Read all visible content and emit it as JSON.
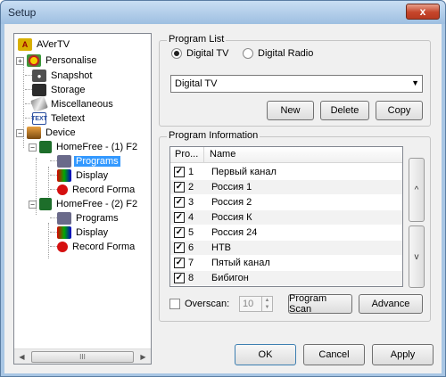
{
  "window": {
    "title": "Setup",
    "close_glyph": "x"
  },
  "tree": {
    "root": "AVerTV",
    "items": [
      {
        "label": "Personalise",
        "icon": "personalise-icon"
      },
      {
        "label": "Snapshot",
        "icon": "camera-icon"
      },
      {
        "label": "Storage",
        "icon": "storage-icon"
      },
      {
        "label": "Miscellaneous",
        "icon": "misc-icon"
      },
      {
        "label": "Teletext",
        "icon": "teletext-icon",
        "icon_text": "TEXT"
      },
      {
        "label": "Device",
        "icon": "device-icon"
      }
    ],
    "devices": [
      {
        "label": "HomeFree - (1) F2",
        "children": [
          "Programs",
          "Display",
          "Record Forma"
        ]
      },
      {
        "label": "HomeFree - (2) F2",
        "children": [
          "Programs",
          "Display",
          "Record Forma"
        ]
      }
    ],
    "expander_plus": "+",
    "expander_minus": "−",
    "scroll_thumb_grip": "III"
  },
  "program_list": {
    "title": "Program List",
    "radio_tv": "Digital TV",
    "radio_radio": "Digital Radio",
    "selected_source": "Digital TV",
    "combo_value": "Digital TV",
    "buttons": {
      "new": "New",
      "delete": "Delete",
      "copy": "Copy"
    }
  },
  "program_info": {
    "title": "Program Information",
    "columns": {
      "num": "Pro...",
      "name": "Name"
    },
    "rows": [
      {
        "num": "1",
        "name": "Первый канал",
        "checked": true
      },
      {
        "num": "2",
        "name": "Россия 1",
        "checked": true
      },
      {
        "num": "3",
        "name": "Россия 2",
        "checked": true
      },
      {
        "num": "4",
        "name": "Россия К",
        "checked": true
      },
      {
        "num": "5",
        "name": "Россия 24",
        "checked": true
      },
      {
        "num": "6",
        "name": "НТВ",
        "checked": true
      },
      {
        "num": "7",
        "name": "Пятый канал",
        "checked": true
      },
      {
        "num": "8",
        "name": "Бибигон",
        "checked": true
      }
    ],
    "move_up": "^",
    "move_down": "v",
    "overscan_label": "Overscan:",
    "overscan_value": "10",
    "buttons": {
      "program_scan": "Program Scan",
      "advance": "Advance"
    }
  },
  "footer": {
    "ok": "OK",
    "cancel": "Cancel",
    "apply": "Apply"
  }
}
